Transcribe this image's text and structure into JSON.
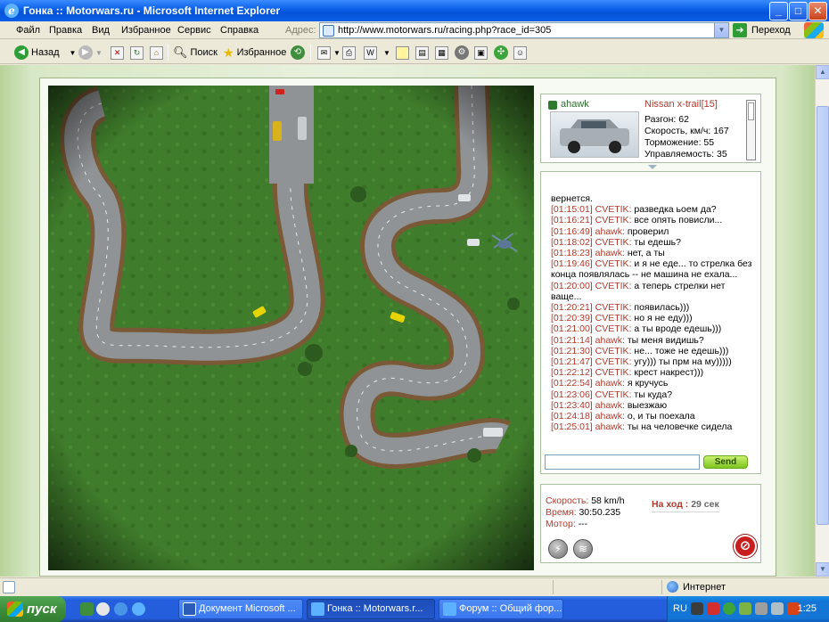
{
  "window": {
    "title": "Гонка :: Motorwars.ru - Microsoft Internet Explorer",
    "minimize": "_",
    "maximize": "□",
    "close": "✕"
  },
  "menu": {
    "items": [
      "Файл",
      "Правка",
      "Вид",
      "Избранное",
      "Сервис",
      "Справка"
    ],
    "address_label": "Адрес:",
    "url": "http://www.motorwars.ru/racing.php?race_id=305",
    "go_label": "Переход"
  },
  "toolbar": {
    "back_label": "Назад",
    "search_label": "Поиск",
    "favorites_label": "Избранное"
  },
  "car": {
    "player": "ahawk",
    "model": "Nissan x-trail[15]",
    "stats": [
      "Разгон: 62",
      "Скорость, км/ч: 167",
      "Торможение: 55",
      "Управляемость: 35"
    ]
  },
  "chat": {
    "messages": [
      {
        "time": "",
        "nick": "",
        "text": "вернется."
      },
      {
        "time": "[01:15:01]",
        "nick": "CVETIK:",
        "text": "разведка ьоем да?"
      },
      {
        "time": "[01:16:21]",
        "nick": "CVETIK:",
        "text": "все опять повисли..."
      },
      {
        "time": "[01:16:49]",
        "nick": "ahawk:",
        "text": "проверил"
      },
      {
        "time": "[01:18:02]",
        "nick": "CVETIK:",
        "text": "ты едешь?"
      },
      {
        "time": "[01:18:23]",
        "nick": "ahawk:",
        "text": "нет, а ты"
      },
      {
        "time": "[01:19:46]",
        "nick": "CVETIK:",
        "text": "и я не еде... то стрелка без конца появлялась -- не машина не ехала..."
      },
      {
        "time": "[01:20:00]",
        "nick": "CVETIK:",
        "text": "а теперь стрелки нет ваще..."
      },
      {
        "time": "[01:20:21]",
        "nick": "CVETIK:",
        "text": "появилась)))"
      },
      {
        "time": "[01:20:39]",
        "nick": "CVETIK:",
        "text": "но я не еду)))"
      },
      {
        "time": "[01:21:00]",
        "nick": "CVETIK:",
        "text": "а ты вроде едешь)))"
      },
      {
        "time": "[01:21:14]",
        "nick": "ahawk:",
        "text": "ты меня видишь?"
      },
      {
        "time": "[01:21:30]",
        "nick": "CVETIK:",
        "text": "не... тоже не едешь)))"
      },
      {
        "time": "[01:21:47]",
        "nick": "CVETIK:",
        "text": "угу)))   ты прм на му)))))"
      },
      {
        "time": "[01:22:12]",
        "nick": "CVETIK:",
        "text": "крест накрест)))"
      },
      {
        "time": "[01:22:54]",
        "nick": "ahawk:",
        "text": "я кручусь"
      },
      {
        "time": "[01:23:06]",
        "nick": "CVETIK:",
        "text": "ты куда?"
      },
      {
        "time": "[01:23:40]",
        "nick": "ahawk:",
        "text": "выезжаю"
      },
      {
        "time": "[01:24:18]",
        "nick": "ahawk:",
        "text": "о, и ты поехала"
      },
      {
        "time": "[01:25:01]",
        "nick": "ahawk:",
        "text": "ты на человечке сидела"
      }
    ],
    "input_value": "",
    "send_label": "Send"
  },
  "status": {
    "speed_label": "Скорость:",
    "speed_value": "58 km/h",
    "time_label": "Время:",
    "time_value": "30:50.235",
    "engine_label": "Мотор:",
    "engine_value": "---",
    "turn_label": "На ход :",
    "turn_value": "29 сек"
  },
  "statusbar": {
    "zone": "Интернет"
  },
  "taskbar": {
    "start_label": "пуск",
    "tasks": [
      "Документ Microsoft ...",
      "Гонка :: Motorwars.r...",
      "Форум :: Общий фор..."
    ],
    "lang": "RU",
    "clock": "1:25"
  },
  "colors": {
    "accent_red": "#B0392B",
    "grass": "#3E7A2A",
    "asphalt": "#8F9194",
    "xp_blue": "#245EDC"
  }
}
